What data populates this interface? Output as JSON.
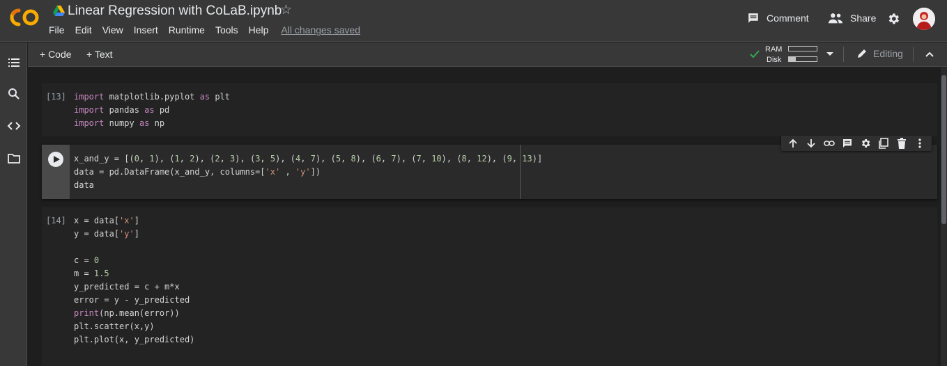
{
  "app": {
    "title": "Linear Regression with CoLaB.ipynb",
    "menu": [
      "File",
      "Edit",
      "View",
      "Insert",
      "Runtime",
      "Tools",
      "Help"
    ],
    "save_status": "All changes saved"
  },
  "header_actions": {
    "comment_label": "Comment",
    "share_label": "Share"
  },
  "toolbar": {
    "add_code_label": "+ Code",
    "add_text_label": "+ Text",
    "ram_label": "RAM",
    "disk_label": "Disk",
    "ram_usage": 0.0,
    "disk_usage": 0.25,
    "editing_label": "Editing"
  },
  "cells": [
    {
      "count": "[13]",
      "lines": [
        [
          [
            "kw",
            "import"
          ],
          [
            "t",
            " matplotlib.pyplot "
          ],
          [
            "kw",
            "as"
          ],
          [
            "t",
            " plt"
          ]
        ],
        [
          [
            "kw",
            "import"
          ],
          [
            "t",
            " pandas "
          ],
          [
            "kw",
            "as"
          ],
          [
            "t",
            " pd"
          ]
        ],
        [
          [
            "kw",
            "import"
          ],
          [
            "t",
            " numpy "
          ],
          [
            "kw",
            "as"
          ],
          [
            "t",
            " np"
          ]
        ]
      ]
    },
    {
      "count": "",
      "lines": [
        [
          [
            "t",
            "x_and_y = [("
          ],
          [
            "num",
            "0"
          ],
          [
            "t",
            ", "
          ],
          [
            "num",
            "1"
          ],
          [
            "t",
            "), ("
          ],
          [
            "num",
            "1"
          ],
          [
            "t",
            ", "
          ],
          [
            "num",
            "2"
          ],
          [
            "t",
            "), ("
          ],
          [
            "num",
            "2"
          ],
          [
            "t",
            ", "
          ],
          [
            "num",
            "3"
          ],
          [
            "t",
            "), ("
          ],
          [
            "num",
            "3"
          ],
          [
            "t",
            ", "
          ],
          [
            "num",
            "5"
          ],
          [
            "t",
            "), ("
          ],
          [
            "num",
            "4"
          ],
          [
            "t",
            ", "
          ],
          [
            "num",
            "7"
          ],
          [
            "t",
            "), ("
          ],
          [
            "num",
            "5"
          ],
          [
            "t",
            ", "
          ],
          [
            "num",
            "8"
          ],
          [
            "t",
            "), ("
          ],
          [
            "num",
            "6"
          ],
          [
            "t",
            ", "
          ],
          [
            "num",
            "7"
          ],
          [
            "t",
            "), ("
          ],
          [
            "num",
            "7"
          ],
          [
            "t",
            ", "
          ],
          [
            "num",
            "10"
          ],
          [
            "t",
            "), ("
          ],
          [
            "num",
            "8"
          ],
          [
            "t",
            ", "
          ],
          [
            "num",
            "12"
          ],
          [
            "t",
            "), ("
          ],
          [
            "num",
            "9"
          ],
          [
            "t",
            ", "
          ],
          [
            "num",
            "13"
          ],
          [
            "t",
            ")]"
          ]
        ],
        [
          [
            "t",
            "data = pd.DataFrame(x_and_y, columns=["
          ],
          [
            "str",
            "'x'"
          ],
          [
            "t",
            " , "
          ],
          [
            "str",
            "'y'"
          ],
          [
            "t",
            "])"
          ]
        ],
        [
          [
            "t",
            "data"
          ]
        ]
      ]
    },
    {
      "count": "[14]",
      "lines": [
        [
          [
            "t",
            "x = data["
          ],
          [
            "str",
            "'x'"
          ],
          [
            "t",
            "]"
          ]
        ],
        [
          [
            "t",
            "y = data["
          ],
          [
            "str",
            "'y'"
          ],
          [
            "t",
            "]"
          ]
        ],
        [
          [
            "t",
            ""
          ]
        ],
        [
          [
            "t",
            "c = "
          ],
          [
            "num",
            "0"
          ]
        ],
        [
          [
            "t",
            "m = "
          ],
          [
            "num",
            "1.5"
          ]
        ],
        [
          [
            "t",
            "y_predicted = c + m*x"
          ]
        ],
        [
          [
            "t",
            "error = y - y_predicted"
          ]
        ],
        [
          [
            "kw",
            "print"
          ],
          [
            "t",
            "(np.mean(error))"
          ]
        ],
        [
          [
            "t",
            "plt.scatter(x,y)"
          ]
        ],
        [
          [
            "t",
            "plt.plot(x, y_predicted)"
          ]
        ]
      ]
    }
  ]
}
